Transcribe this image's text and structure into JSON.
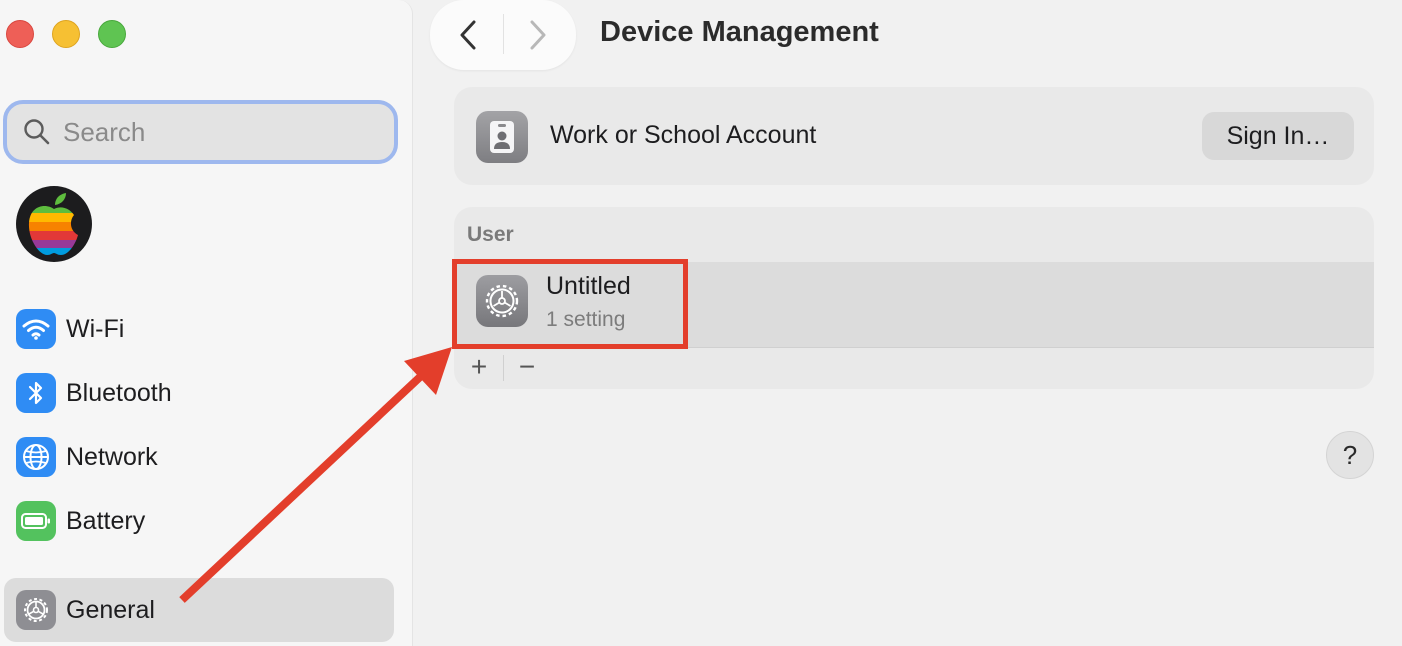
{
  "window": {
    "traffic_lights": [
      "close",
      "minimize",
      "zoom"
    ]
  },
  "sidebar": {
    "search_placeholder": "Search",
    "items": [
      {
        "label": "Wi-Fi",
        "icon": "wifi-icon",
        "color": "#2f8cf4"
      },
      {
        "label": "Bluetooth",
        "icon": "bluetooth-icon",
        "color": "#2f8cf4"
      },
      {
        "label": "Network",
        "icon": "globe-icon",
        "color": "#2f8cf4"
      },
      {
        "label": "Battery",
        "icon": "battery-icon",
        "color": "#53c25e"
      },
      {
        "label": "General",
        "icon": "gear-icon",
        "color": "#8e8e93",
        "selected": true
      }
    ]
  },
  "header": {
    "title": "Device Management"
  },
  "account": {
    "label": "Work or School Account",
    "button": "Sign In…"
  },
  "profiles": {
    "section_title": "User",
    "items": [
      {
        "name": "Untitled",
        "subtitle": "1 setting"
      }
    ],
    "add_label": "+",
    "remove_label": "−"
  },
  "help": {
    "label": "?"
  },
  "annotation": {
    "color": "#e33e2b"
  }
}
